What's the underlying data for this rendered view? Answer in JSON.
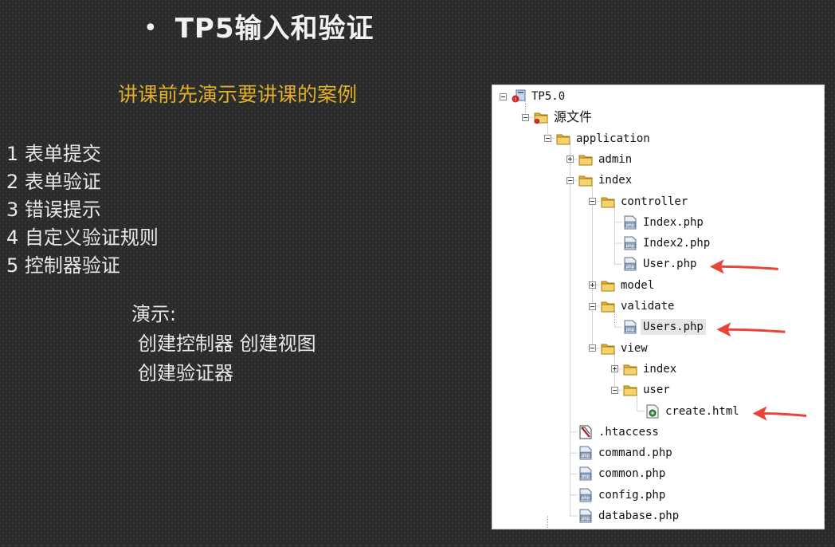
{
  "slide": {
    "bullet": "•",
    "title": "TP5输入和验证",
    "subtitle": "讲课前先演示要讲课的案例",
    "list": [
      "1 表单提交",
      "2 表单验证",
      "3 错误提示",
      "4 自定义验证规则",
      "5 控制器验证"
    ],
    "demo": {
      "heading": "演示:",
      "line1": "创建控制器 创建视图",
      "line2": "创建验证器"
    },
    "colors": {
      "subtitle": "#e0b02a",
      "arrow": "#e8443a"
    }
  },
  "tree": [
    {
      "label": "TP5.0",
      "icon": "project-icon",
      "toggle": "minus",
      "depth": 0
    },
    {
      "label": "源文件",
      "icon": "source-folder-icon",
      "toggle": "minus",
      "depth": 1
    },
    {
      "label": "application",
      "icon": "folder-icon",
      "toggle": "minus",
      "depth": 2
    },
    {
      "label": "admin",
      "icon": "folder-icon",
      "toggle": "plus",
      "depth": 3
    },
    {
      "label": "index",
      "icon": "folder-icon",
      "toggle": "minus",
      "depth": 3
    },
    {
      "label": "controller",
      "icon": "folder-icon",
      "toggle": "minus",
      "depth": 4
    },
    {
      "label": "Index.php",
      "icon": "php-file-icon",
      "toggle": null,
      "depth": 5
    },
    {
      "label": "Index2.php",
      "icon": "php-file-icon",
      "toggle": null,
      "depth": 5
    },
    {
      "label": "User.php",
      "icon": "php-file-icon",
      "toggle": null,
      "depth": 5,
      "arrow": true
    },
    {
      "label": "model",
      "icon": "folder-icon",
      "toggle": "plus",
      "depth": 4
    },
    {
      "label": "validate",
      "icon": "folder-icon",
      "toggle": "minus",
      "depth": 4
    },
    {
      "label": "Users.php",
      "icon": "php-file-icon",
      "toggle": null,
      "depth": 5,
      "arrow": true,
      "selected": true
    },
    {
      "label": "view",
      "icon": "folder-icon",
      "toggle": "minus",
      "depth": 4
    },
    {
      "label": "index",
      "icon": "folder-icon",
      "toggle": "plus",
      "depth": 5
    },
    {
      "label": "user",
      "icon": "folder-icon",
      "toggle": "minus",
      "depth": 5
    },
    {
      "label": "create.html",
      "icon": "html-file-icon",
      "toggle": null,
      "depth": 6,
      "arrow": true
    },
    {
      "label": ".htaccess",
      "icon": "htaccess-file-icon",
      "toggle": null,
      "depth": 3
    },
    {
      "label": "command.php",
      "icon": "php-file-icon",
      "toggle": null,
      "depth": 3
    },
    {
      "label": "common.php",
      "icon": "php-file-icon",
      "toggle": null,
      "depth": 3
    },
    {
      "label": "config.php",
      "icon": "php-file-icon",
      "toggle": null,
      "depth": 3
    },
    {
      "label": "database.php",
      "icon": "php-file-icon",
      "toggle": null,
      "depth": 3
    }
  ]
}
